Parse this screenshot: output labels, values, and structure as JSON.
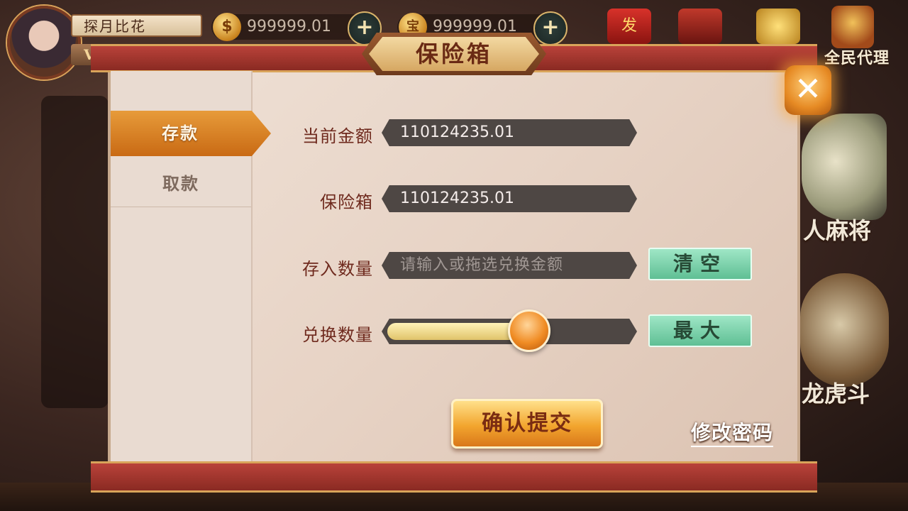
{
  "player": {
    "name": "探月比花",
    "vip": "V"
  },
  "balances": {
    "gold": "999999.01",
    "treasure": "999999.01",
    "treasure_symbol": "宝",
    "gold_symbol": "$"
  },
  "top_icons": [
    {
      "name": "red-envelope-icon",
      "glyph": "发"
    },
    {
      "name": "treasure-chest-icon",
      "glyph": ""
    },
    {
      "name": "gold-coins-icon",
      "glyph": ""
    }
  ],
  "agent": {
    "label": "全民代理"
  },
  "side_games": {
    "mahjong_label": "人麻将",
    "tiger_label": "龙虎斗"
  },
  "modal": {
    "title": "保险箱",
    "close_glyph": "✕",
    "tabs": [
      {
        "label": "存款",
        "active": true
      },
      {
        "label": "取款",
        "active": false
      }
    ],
    "fields": {
      "current_amount": {
        "label": "当前金额",
        "value": "110124235.01"
      },
      "safe_box": {
        "label": "保险箱",
        "value": "110124235.01"
      },
      "deposit_amount": {
        "label": "存入数量",
        "placeholder": "请输入或拖选兑换金额"
      },
      "exchange_amount": {
        "label": "兑换数量",
        "slider_fraction": 0.58
      }
    },
    "clear_button": "清空",
    "max_button": "最大",
    "confirm_button": "确认提交",
    "change_password": "修改密码"
  },
  "colors": {
    "accent": "#e08a26",
    "label": "#6f2a1e",
    "green": "#7fd3ac",
    "band": "#a8362e"
  }
}
